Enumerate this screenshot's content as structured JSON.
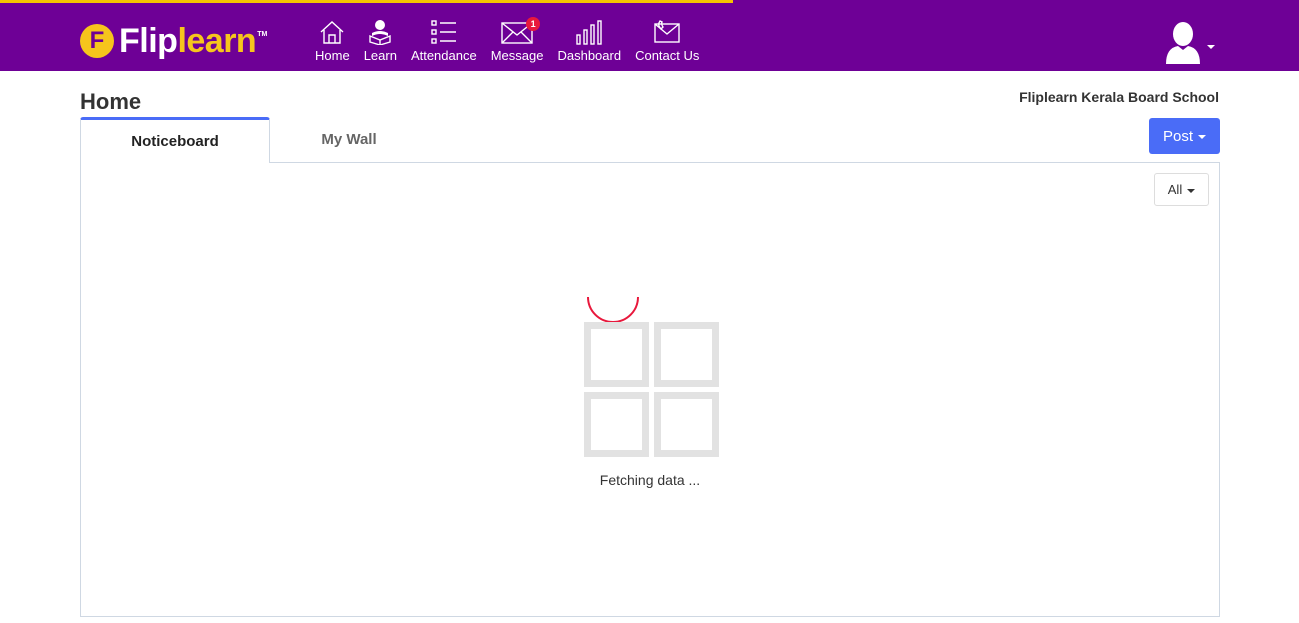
{
  "brand": {
    "logo_letter": "F",
    "logo_white": "Flip",
    "logo_yellow": "learn",
    "trademark": "TM"
  },
  "colors": {
    "topbar": "#6e0096",
    "progress": "#f5c400",
    "accent": "#4a6cf7",
    "badge": "#e8183c"
  },
  "nav": {
    "items": [
      {
        "label": "Home",
        "icon": "home-icon"
      },
      {
        "label": "Learn",
        "icon": "learn-icon"
      },
      {
        "label": "Attendance",
        "icon": "attendance-list-icon"
      },
      {
        "label": "Message",
        "icon": "envelope-icon",
        "badge": "1"
      },
      {
        "label": "Dashboard",
        "icon": "bar-chart-icon"
      },
      {
        "label": "Contact Us",
        "icon": "contact-envelope-icon"
      }
    ]
  },
  "user": {
    "icon": "user-avatar-icon"
  },
  "page": {
    "title": "Home",
    "school": "Fliplearn Kerala Board School"
  },
  "tabs": [
    {
      "label": "Noticeboard",
      "active": true
    },
    {
      "label": "My Wall",
      "active": false
    }
  ],
  "post_button": {
    "label": "Post"
  },
  "filter": {
    "selected": "All"
  },
  "loading": {
    "text": "Fetching data ..."
  }
}
